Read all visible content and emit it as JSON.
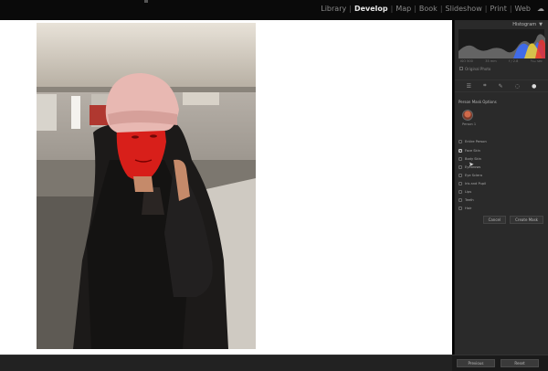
{
  "modules": [
    "Library",
    "Develop",
    "Map",
    "Book",
    "Slideshow",
    "Print",
    "Web"
  ],
  "active_module": "Develop",
  "panel": {
    "title": "Histogram",
    "histogram_labels": [
      "ISO 500",
      "35 mm",
      "f / 2.8",
      "¹⁄₂₅₀ sec"
    ],
    "original_photo": "Original Photo",
    "section_title": "Person Mask Options",
    "person_label": "Person 1",
    "options": [
      {
        "label": "Entire Person",
        "checked": false
      },
      {
        "label": "Face Skin",
        "checked": true
      },
      {
        "label": "Body Skin",
        "checked": false
      },
      {
        "label": "Eyebrows",
        "checked": false
      },
      {
        "label": "Eye Sclera",
        "checked": false
      },
      {
        "label": "Iris and Pupil",
        "checked": false
      },
      {
        "label": "Lips",
        "checked": false
      },
      {
        "label": "Teeth",
        "checked": false
      },
      {
        "label": "Hair",
        "checked": false
      }
    ],
    "cancel_label": "Cancel",
    "create_label": "Create Mask"
  },
  "bottom": {
    "previous_label": "Previous",
    "reset_label": "Reset"
  },
  "colors": {
    "mask_overlay": "#e8201a",
    "histogram_blue": "#3a6cff",
    "histogram_yellow": "#f0d030",
    "histogram_red": "#e83030"
  },
  "icons": {
    "cloud": "cloud-icon",
    "panel_collapse": "triangle-down-icon"
  }
}
